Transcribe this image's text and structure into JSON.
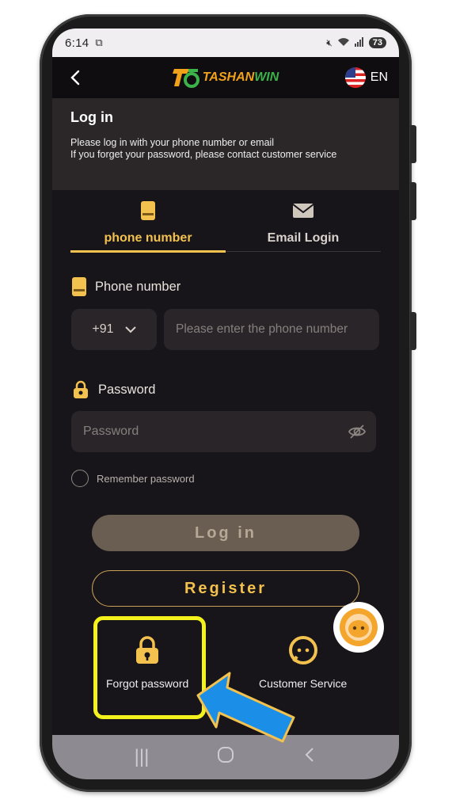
{
  "status_bar": {
    "time": "6:14",
    "battery": "73"
  },
  "header": {
    "back_icon": "chevron-left-icon",
    "brand_part1": "TASHAN",
    "brand_part2": "WIN",
    "language": "EN"
  },
  "intro": {
    "title": "Log in",
    "line1": "Please log in with your phone number or email",
    "line2": "If you forget your password, please contact customer service"
  },
  "tabs": [
    {
      "label": "phone number",
      "icon": "phone-icon",
      "active": true
    },
    {
      "label": "Email Login",
      "icon": "mail-icon",
      "active": false
    }
  ],
  "phone_field": {
    "label": "Phone number",
    "country_code": "+91",
    "placeholder": "Please enter the phone number"
  },
  "password_field": {
    "label": "Password",
    "placeholder": "Password"
  },
  "remember_label": "Remember password",
  "login_button": "Log in",
  "register_button": "Register",
  "bottom_actions": {
    "forgot_password": "Forgot password",
    "customer_service": "Customer Service"
  },
  "colors": {
    "accent": "#f3c14e",
    "background": "#17141a",
    "highlight": "#f3f21c",
    "arrow": "#1b8ee8"
  }
}
